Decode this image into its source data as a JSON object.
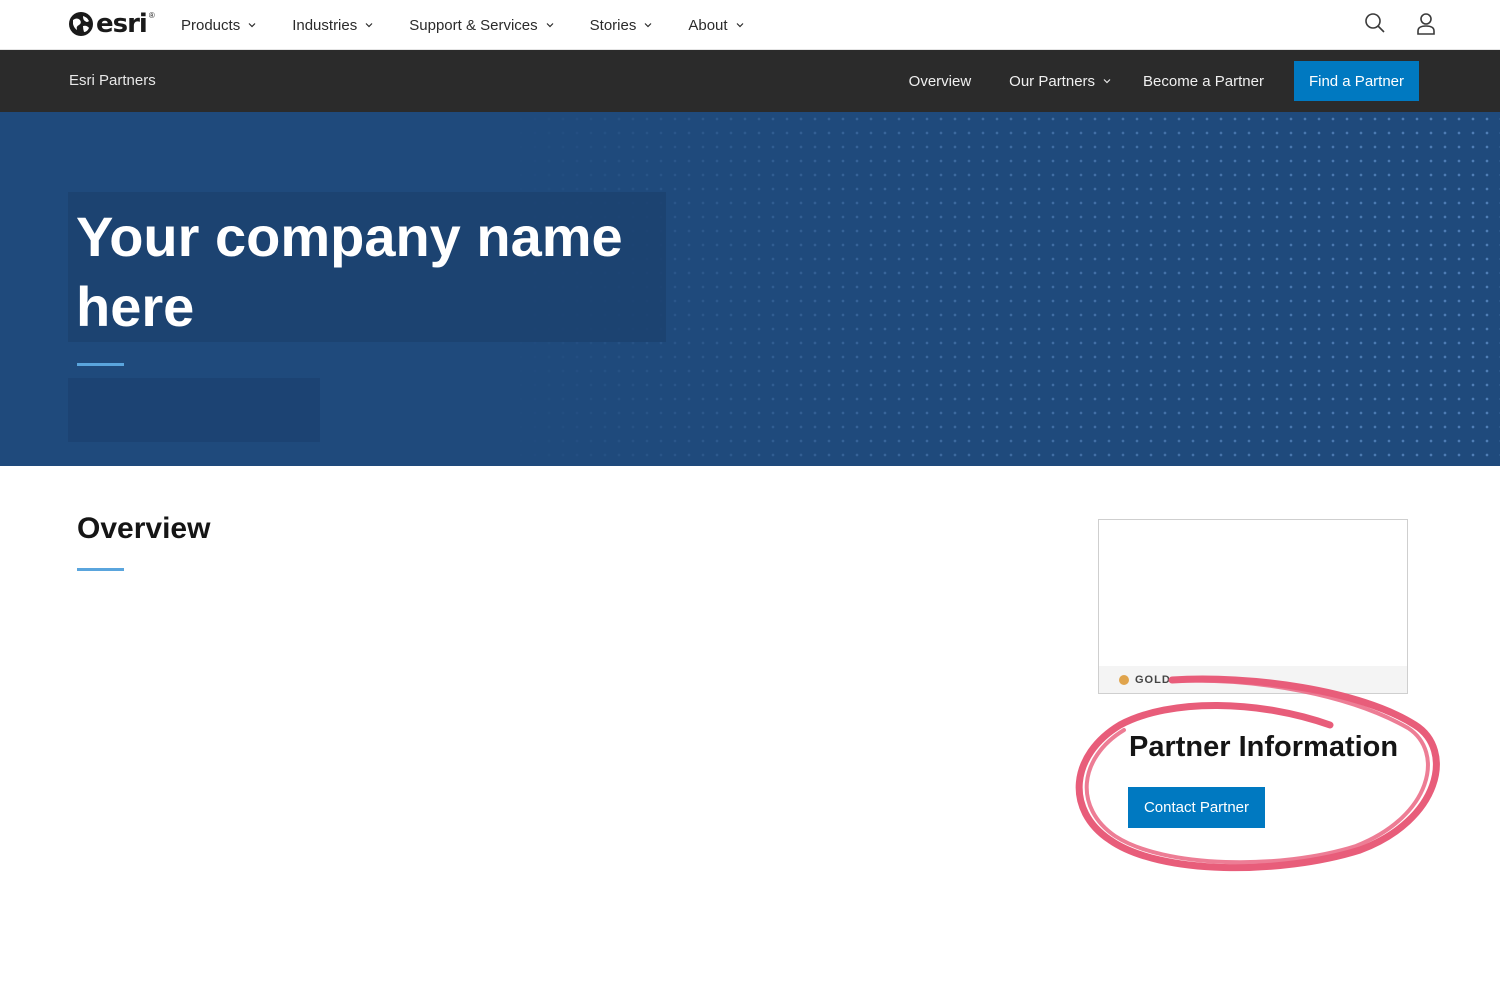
{
  "global_nav": {
    "logo_text": "esri",
    "logo_mark": "®",
    "items": [
      {
        "label": "Products"
      },
      {
        "label": "Industries"
      },
      {
        "label": "Support & Services"
      },
      {
        "label": "Stories"
      },
      {
        "label": "About"
      }
    ],
    "icons": [
      "search-icon",
      "user-icon"
    ]
  },
  "sub_nav": {
    "title": "Esri Partners",
    "links": [
      {
        "label": "Overview"
      },
      {
        "label": "Our Partners"
      },
      {
        "label": "Become a Partner"
      }
    ],
    "cta": "Find a Partner"
  },
  "hero": {
    "title": "Your company name here"
  },
  "overview": {
    "title": "Overview"
  },
  "partner_card": {
    "tier": "GOLD",
    "tier_color": "#e0a44c"
  },
  "partner_info": {
    "title": "Partner Information",
    "contact_button": "Contact Partner"
  },
  "colors": {
    "brand_blue": "#0079c1",
    "hero_bg": "#1f4a7c",
    "subnav_bg": "#2b2b2b",
    "annotation": "#e85d7a"
  }
}
